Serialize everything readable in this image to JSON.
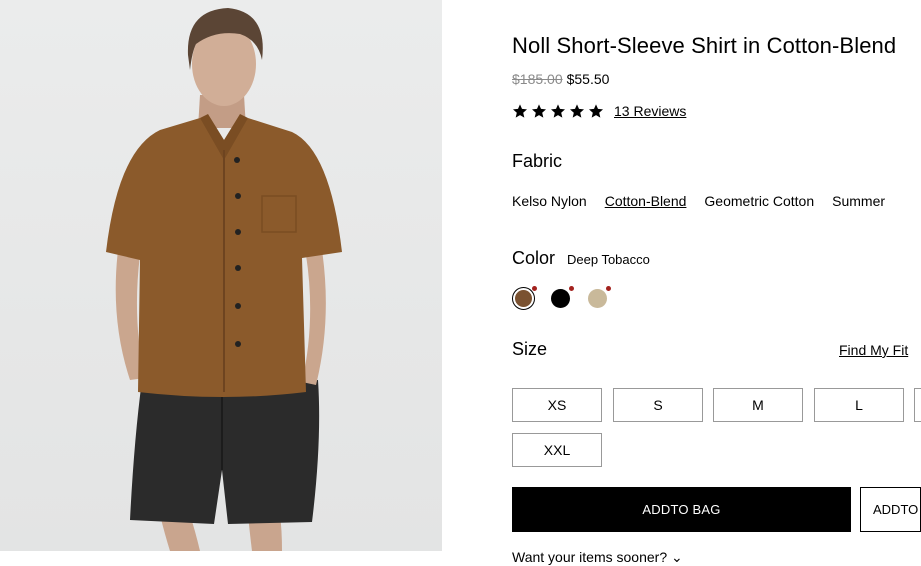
{
  "product": {
    "title": "Noll Short-Sleeve Shirt in Cotton-Blend",
    "price_original": "$185.00",
    "price_sale": "$55.50",
    "rating_stars": 5,
    "reviews_label": "13 Reviews"
  },
  "fabric": {
    "label": "Fabric",
    "options": [
      "Kelso Nylon",
      "Cotton-Blend",
      "Geometric Cotton",
      "Summer"
    ],
    "selected_index": 1
  },
  "color": {
    "label": "Color",
    "selected_name": "Deep Tobacco",
    "swatches": [
      {
        "name": "Deep Tobacco",
        "hex": "#7a5231",
        "sale_dot": "#a3221e"
      },
      {
        "name": "Black",
        "hex": "#000000",
        "sale_dot": "#a3221e"
      },
      {
        "name": "Khaki",
        "hex": "#c9b99a",
        "sale_dot": "#a3221e"
      }
    ]
  },
  "size": {
    "label": "Size",
    "find_fit": "Find My Fit",
    "options": [
      "XS",
      "S",
      "M",
      "L",
      "",
      "XXL"
    ]
  },
  "actions": {
    "add_to_bag": "ADDTO BAG",
    "add_to_wishlist": "ADDTO WISHLIST",
    "want_soon": "Want your items sooner?"
  }
}
